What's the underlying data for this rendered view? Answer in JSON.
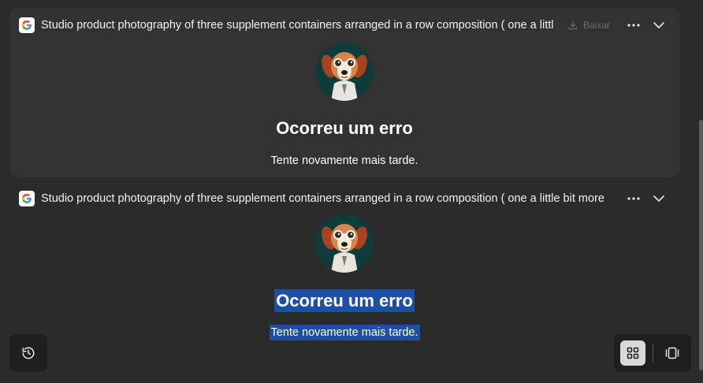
{
  "cards": [
    {
      "title": "Studio product photography of three supplement containers arranged in a row composition ( one a little bit more",
      "download_label": "Baixar",
      "error_title": "Ocorreu um erro",
      "error_message": "Tente novamente mais tarde."
    },
    {
      "title": "Studio product photography of three supplement containers arranged in a row composition ( one a little bit more",
      "error_title": "Ocorreu um erro",
      "error_message": "Tente novamente mais tarde."
    }
  ],
  "icons": {
    "provider": "google-g-icon",
    "download": "download-icon",
    "more": "more-horizontal-icon",
    "expand": "chevron-down-icon",
    "history": "history-icon",
    "grid_view": "grid-view-icon",
    "single_view": "single-view-icon"
  },
  "colors": {
    "background": "#2b2b2b",
    "card": "#323232",
    "selection_highlight": "#1e4fa6",
    "control_bg": "#1f1f1f"
  },
  "state": {
    "active_view": "grid"
  }
}
